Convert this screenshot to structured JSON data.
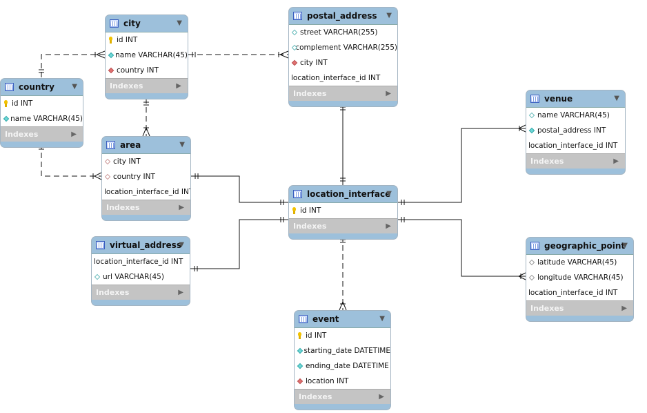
{
  "diagram": {
    "indexes_label": "Indexes",
    "tables": [
      {
        "id": "city",
        "name": "city",
        "columns": [
          {
            "text": "id INT",
            "icon": "key"
          },
          {
            "text": "name VARCHAR(45)",
            "icon": "d-nn"
          },
          {
            "text": "country INT",
            "icon": "d-fk"
          }
        ]
      },
      {
        "id": "postal_address",
        "name": "postal_address",
        "columns": [
          {
            "text": "street VARCHAR(255)",
            "icon": "d-null"
          },
          {
            "text": "complement VARCHAR(255)",
            "icon": "d-null"
          },
          {
            "text": "city INT",
            "icon": "d-fk"
          },
          {
            "text": "location_interface_id INT",
            "icon": "none"
          }
        ]
      },
      {
        "id": "country",
        "name": "country",
        "columns": [
          {
            "text": "id INT",
            "icon": "key"
          },
          {
            "text": "name VARCHAR(45)",
            "icon": "d-nn"
          }
        ]
      },
      {
        "id": "venue",
        "name": "venue",
        "columns": [
          {
            "text": "name VARCHAR(45)",
            "icon": "d-null"
          },
          {
            "text": "postal_address INT",
            "icon": "d-nn"
          },
          {
            "text": "location_interface_id INT",
            "icon": "none"
          }
        ]
      },
      {
        "id": "area",
        "name": "area",
        "columns": [
          {
            "text": "city INT",
            "icon": "d-fkn"
          },
          {
            "text": "country INT",
            "icon": "d-fkn"
          },
          {
            "text": "location_interface_id INT",
            "icon": "none"
          }
        ]
      },
      {
        "id": "location_interface",
        "name": "location_interface",
        "columns": [
          {
            "text": "id INT",
            "icon": "key"
          }
        ]
      },
      {
        "id": "virtual_address",
        "name": "virtual_address",
        "columns": [
          {
            "text": "location_interface_id INT",
            "icon": "none"
          },
          {
            "text": "url VARCHAR(45)",
            "icon": "d-null"
          }
        ]
      },
      {
        "id": "geographic_point",
        "name": "geographic_point",
        "columns": [
          {
            "text": "latitude VARCHAR(45)",
            "icon": "d-grey"
          },
          {
            "text": "longitude VARCHAR(45)",
            "icon": "d-grey"
          },
          {
            "text": "location_interface_id INT",
            "icon": "none"
          }
        ]
      },
      {
        "id": "event",
        "name": "event",
        "columns": [
          {
            "text": "id INT",
            "icon": "key"
          },
          {
            "text": "starting_date DATETIME",
            "icon": "d-nn"
          },
          {
            "text": "ending_date DATETIME",
            "icon": "d-nn"
          },
          {
            "text": "location INT",
            "icon": "d-fk"
          }
        ]
      }
    ],
    "relationships": [
      {
        "from": "city",
        "to": "country",
        "style": "dashed"
      },
      {
        "from": "postal_address",
        "to": "city",
        "style": "dashed"
      },
      {
        "from": "area",
        "to": "city",
        "style": "dashed"
      },
      {
        "from": "area",
        "to": "country",
        "style": "dashed"
      },
      {
        "from": "area",
        "to": "location_interface",
        "style": "solid"
      },
      {
        "from": "virtual_address",
        "to": "location_interface",
        "style": "solid"
      },
      {
        "from": "postal_address",
        "to": "location_interface",
        "style": "solid"
      },
      {
        "from": "venue",
        "to": "location_interface",
        "style": "solid"
      },
      {
        "from": "geographic_point",
        "to": "location_interface",
        "style": "solid"
      },
      {
        "from": "event",
        "to": "location_interface",
        "style": "dashed"
      }
    ]
  }
}
